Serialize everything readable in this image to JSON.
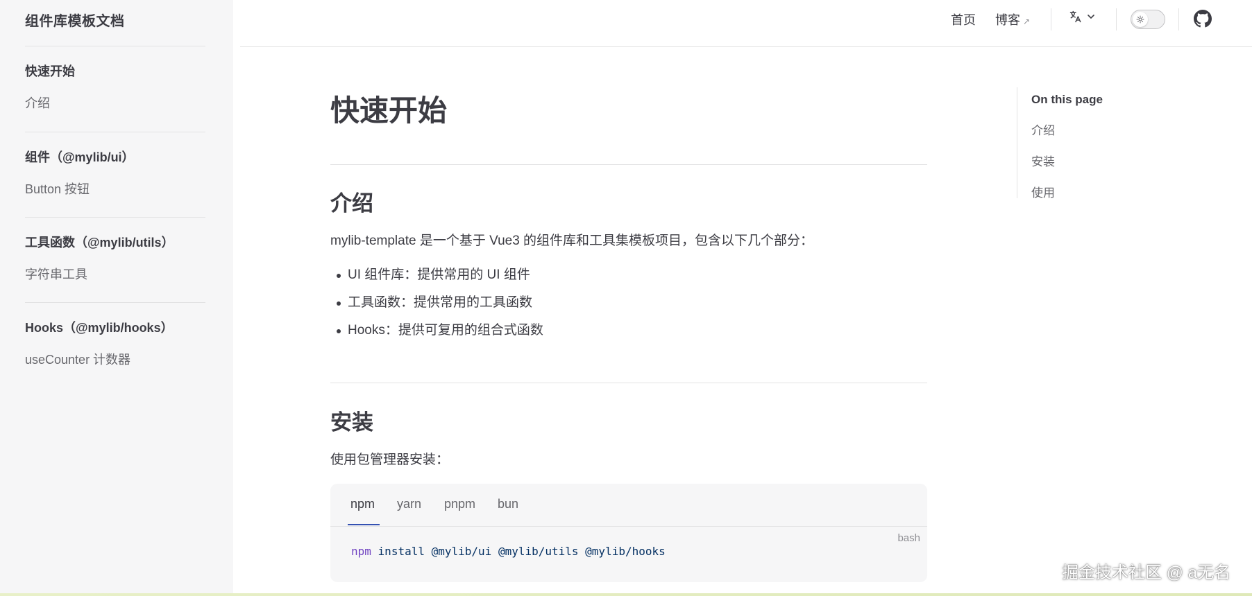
{
  "site": {
    "title": "组件库模板文档"
  },
  "sidebar": {
    "groups": [
      {
        "title": "快速开始",
        "items": [
          "介绍"
        ]
      },
      {
        "title": "组件（@mylib/ui）",
        "items": [
          "Button 按钮"
        ]
      },
      {
        "title": "工具函数（@mylib/utils）",
        "items": [
          "字符串工具"
        ]
      },
      {
        "title": "Hooks（@mylib/hooks）",
        "items": [
          "useCounter 计数器"
        ]
      }
    ]
  },
  "nav": {
    "home": "首页",
    "blog": "博客",
    "blog_external": "↗",
    "language_icon": "translate-icon",
    "theme_icon": "sun-icon",
    "github_icon": "github-icon"
  },
  "main": {
    "title": "快速开始",
    "intro": {
      "heading": "介绍",
      "paragraph": "mylib-template 是一个基于 Vue3 的组件库和工具集模板项目，包含以下几个部分：",
      "list": [
        "UI 组件库：提供常用的 UI 组件",
        "工具函数：提供常用的工具函数",
        "Hooks：提供可复用的组合式函数"
      ]
    },
    "install": {
      "heading": "安装",
      "paragraph": "使用包管理器安装：",
      "tabs": [
        "npm",
        "yarn",
        "pnpm",
        "bun"
      ],
      "active_tab": "npm",
      "code_lang": "bash",
      "code_cmd": "npm",
      "code_args": "install @mylib/ui @mylib/utils @mylib/hooks"
    }
  },
  "outline": {
    "title": "On this page",
    "items": [
      "介绍",
      "安装",
      "使用"
    ]
  },
  "watermark": "掘金技术社区 @ a无名",
  "colors": {
    "accent": "#3451b2",
    "sidebar_bg": "#f6f6f7",
    "text": "#3c3c43",
    "muted": "#67676c"
  }
}
